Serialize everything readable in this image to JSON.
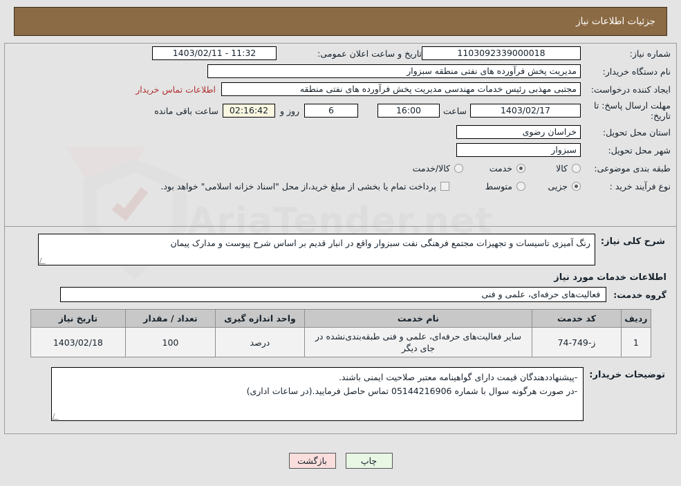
{
  "header": {
    "title": "جزئیات اطلاعات نیاز"
  },
  "watermark": {
    "text": "AriaTender.net"
  },
  "form": {
    "need_number_label": "شماره نیاز:",
    "need_number_value": "1103092339000018",
    "announce_label": "تاریخ و ساعت اعلان عمومی:",
    "announce_value": "11:32 - 1403/02/11",
    "buyer_org_label": "نام دستگاه خریدار:",
    "buyer_org_value": "مدیریت پخش فرآورده های نفتی منطقه سبزوار",
    "requester_label": "ایجاد کننده درخواست:",
    "requester_value": "مجتبی مهذبی رئیس خدمات مهندسی مدیریت پخش فرآورده های نفتی منطقه",
    "contact_link": "اطلاعات تماس خریدار",
    "deadline_label": "مهلت ارسال پاسخ: تا تاریخ:",
    "deadline_date": "1403/02/17",
    "time_label": "ساعت",
    "deadline_time": "16:00",
    "days_value": "6",
    "days_label": "روز و",
    "countdown_value": "02:16:42",
    "remaining_label": "ساعت باقی مانده",
    "province_label": "استان محل تحویل:",
    "province_value": "خراسان رضوی",
    "city_label": "شهر محل تحویل:",
    "city_value": "سبزوار",
    "category_label": "طبقه بندی موضوعی:",
    "category_options": [
      {
        "label": "کالا",
        "selected": false
      },
      {
        "label": "خدمت",
        "selected": true
      },
      {
        "label": "کالا/خدمت",
        "selected": false
      }
    ],
    "process_label": "نوع فرآیند خرید :",
    "process_options": [
      {
        "label": "جزیی",
        "selected": true
      },
      {
        "label": "متوسط",
        "selected": false
      }
    ],
    "treasury_checkbox_label": "پرداخت تمام یا بخشی از مبلغ خرید،از محل \"اسناد خزانه اسلامی\" خواهد بود.",
    "treasury_checked": false
  },
  "description": {
    "label": "شرح کلی نیاز:",
    "value": "رنگ آمیزی تاسیسات و تجهیزات مجتمع فرهنگی نفت سبزوار واقع در انبار قدیم بر اساس شرح پیوست و مدارک پیمان"
  },
  "services": {
    "section_title": "اطلاعات خدمات مورد نیاز",
    "group_label": "گروه خدمت:",
    "group_value": "فعالیت‌های حرفه‌ای، علمی و فنی",
    "table": {
      "columns": [
        "ردیف",
        "کد خدمت",
        "نام خدمت",
        "واحد اندازه گیری",
        "تعداد / مقدار",
        "تاریخ نیاز"
      ],
      "rows": [
        {
          "index": "1",
          "code": "ز-749-74",
          "name": "سایر فعالیت‌های حرفه‌ای، علمی و فنی طبقه‌بندی‌نشده در جای دیگر",
          "unit": "درصد",
          "quantity": "100",
          "date": "1403/02/18"
        }
      ]
    }
  },
  "notes": {
    "label": "توضیحات خریدار:",
    "lines": [
      "-پیشنهاددهندگان قیمت دارای گواهینامه معتبر صلاحیت ایمنی باشند.",
      "-در صورت هرگونه سوال با شماره 05144216906 تماس حاصل فرمایید.(در ساعات اداری)"
    ]
  },
  "buttons": {
    "print": "چاپ",
    "back": "بازگشت"
  },
  "colors": {
    "header_bg": "#8b6b45",
    "page_bg": "#e4e4e4",
    "link": "#b03030",
    "print_bg": "#e8f6e4",
    "back_bg": "#fadddd",
    "countdown_bg": "#faf7e0"
  }
}
